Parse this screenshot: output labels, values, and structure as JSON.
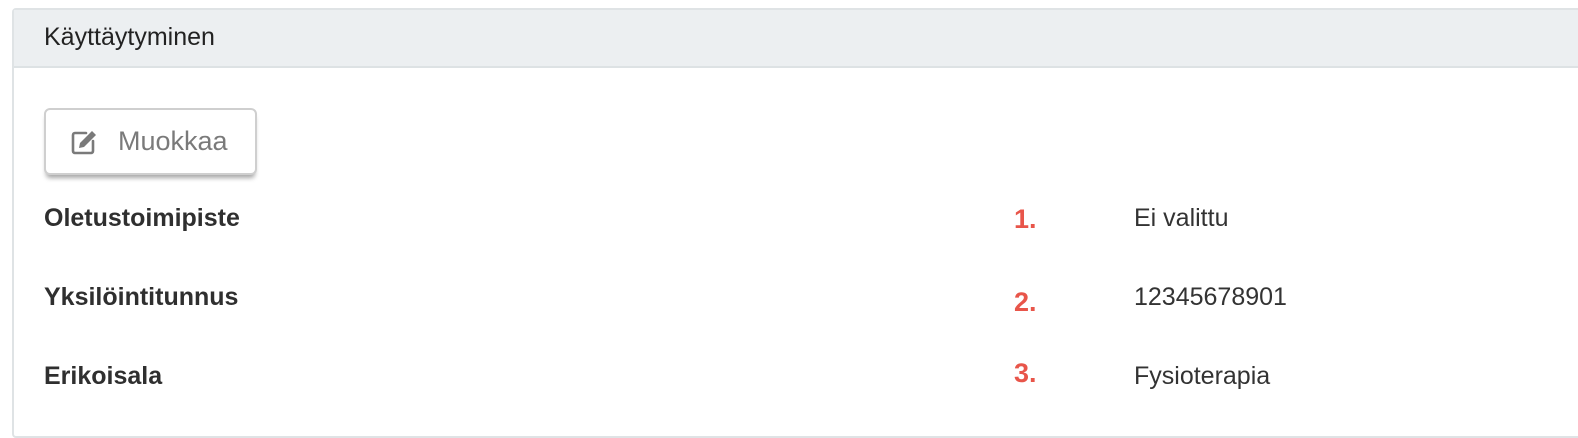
{
  "panel": {
    "title": "Käyttäytyminen",
    "edit_button_label": "Muokkaa",
    "edit_icon": "edit-icon"
  },
  "fields": [
    {
      "label": "Oletustoimipiste",
      "marker": "1.",
      "value": "Ei valittu"
    },
    {
      "label": "Yksilöintitunnus",
      "marker": "2.",
      "value": "12345678901"
    },
    {
      "label": "Erikoisala",
      "marker": "3.",
      "value": "Fysioterapia"
    }
  ],
  "colors": {
    "heading_background": "#eceff1",
    "marker": "#e8554a",
    "button_text": "#7a7a7a"
  }
}
